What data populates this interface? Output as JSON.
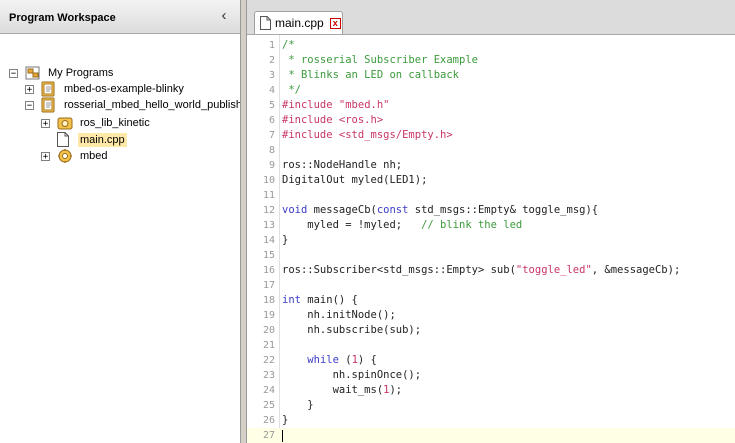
{
  "sidebar": {
    "title": "Program Workspace",
    "tree": [
      {
        "label": "My Programs",
        "expander": "−",
        "icon": "workspace-icon"
      },
      {
        "label": "mbed-os-example-blinky",
        "expander": "+",
        "icon": "program-icon"
      },
      {
        "label": "rosserial_mbed_hello_world_publisher",
        "expander": "−",
        "icon": "program-icon"
      },
      {
        "label": "ros_lib_kinetic",
        "expander": "+",
        "icon": "library-icon"
      },
      {
        "label": "main.cpp",
        "expander": "",
        "icon": "file-icon",
        "selected": true
      },
      {
        "label": "mbed",
        "expander": "+",
        "icon": "gear-library-icon"
      }
    ]
  },
  "editor": {
    "tab": {
      "label": "main.cpp",
      "close": "x"
    },
    "lines": [
      {
        "n": "1",
        "parts": [
          {
            "t": "/*",
            "c": "comment"
          }
        ]
      },
      {
        "n": "2",
        "parts": [
          {
            "t": " * rosserial Subscriber Example",
            "c": "comment"
          }
        ]
      },
      {
        "n": "3",
        "parts": [
          {
            "t": " * Blinks an LED on callback",
            "c": "comment"
          }
        ]
      },
      {
        "n": "4",
        "parts": [
          {
            "t": " */",
            "c": "comment"
          }
        ]
      },
      {
        "n": "5",
        "parts": [
          {
            "t": "#include ",
            "c": "pre"
          },
          {
            "t": "\"mbed.h\"",
            "c": "str"
          }
        ]
      },
      {
        "n": "6",
        "parts": [
          {
            "t": "#include <ros.h>",
            "c": "pre"
          }
        ]
      },
      {
        "n": "7",
        "parts": [
          {
            "t": "#include <std_msgs/Empty.h>",
            "c": "pre"
          }
        ]
      },
      {
        "n": "8",
        "parts": []
      },
      {
        "n": "9",
        "parts": [
          {
            "t": "ros::NodeHandle nh;",
            "c": "normal"
          }
        ]
      },
      {
        "n": "10",
        "parts": [
          {
            "t": "DigitalOut myled(LED1);",
            "c": "normal"
          }
        ]
      },
      {
        "n": "11",
        "parts": []
      },
      {
        "n": "12",
        "parts": [
          {
            "t": "void",
            "c": "kw"
          },
          {
            "t": " messageCb(",
            "c": "normal"
          },
          {
            "t": "const",
            "c": "kw"
          },
          {
            "t": " std_msgs::Empty& toggle_msg){",
            "c": "normal"
          }
        ]
      },
      {
        "n": "13",
        "parts": [
          {
            "t": "    myled = !myled;   ",
            "c": "normal"
          },
          {
            "t": "// blink the led",
            "c": "comment"
          }
        ]
      },
      {
        "n": "14",
        "parts": [
          {
            "t": "}",
            "c": "normal"
          }
        ]
      },
      {
        "n": "15",
        "parts": []
      },
      {
        "n": "16",
        "parts": [
          {
            "t": "ros::Subscriber<std_msgs::Empty> sub(",
            "c": "normal"
          },
          {
            "t": "\"toggle_led\"",
            "c": "str"
          },
          {
            "t": ", &messageCb);",
            "c": "normal"
          }
        ]
      },
      {
        "n": "17",
        "parts": []
      },
      {
        "n": "18",
        "parts": [
          {
            "t": "int",
            "c": "kw"
          },
          {
            "t": " main() {",
            "c": "normal"
          }
        ]
      },
      {
        "n": "19",
        "parts": [
          {
            "t": "    nh.initNode();",
            "c": "normal"
          }
        ]
      },
      {
        "n": "20",
        "parts": [
          {
            "t": "    nh.subscribe(sub);",
            "c": "normal"
          }
        ]
      },
      {
        "n": "21",
        "parts": []
      },
      {
        "n": "22",
        "parts": [
          {
            "t": "    ",
            "c": "normal"
          },
          {
            "t": "while",
            "c": "kw"
          },
          {
            "t": " (",
            "c": "normal"
          },
          {
            "t": "1",
            "c": "num"
          },
          {
            "t": ") {",
            "c": "normal"
          }
        ]
      },
      {
        "n": "23",
        "parts": [
          {
            "t": "        nh.spinOnce();",
            "c": "normal"
          }
        ]
      },
      {
        "n": "24",
        "parts": [
          {
            "t": "        wait_ms(",
            "c": "normal"
          },
          {
            "t": "1",
            "c": "num"
          },
          {
            "t": ");",
            "c": "normal"
          }
        ]
      },
      {
        "n": "25",
        "parts": [
          {
            "t": "    }",
            "c": "normal"
          }
        ]
      },
      {
        "n": "26",
        "parts": [
          {
            "t": "}",
            "c": "normal"
          }
        ]
      },
      {
        "n": "27",
        "parts": [],
        "current": true
      }
    ]
  }
}
